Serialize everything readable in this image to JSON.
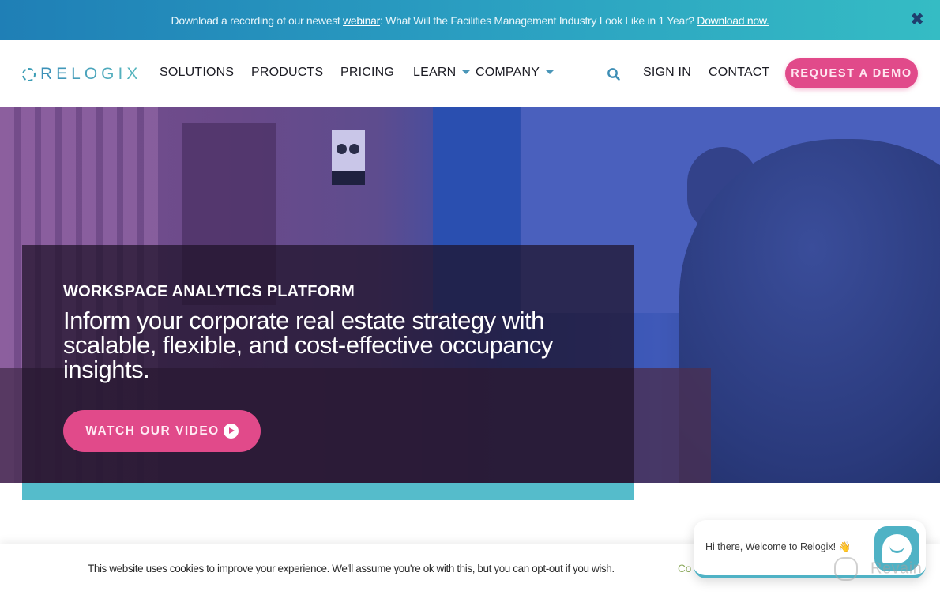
{
  "announcement": {
    "text_before": "Download a recording of our newest ",
    "webinar_link": "webinar",
    "text_middle": ": What Will the Facilities Management Industry Look Like in 1 Year? ",
    "download_link": "Download now.",
    "close_icon": "✖"
  },
  "header": {
    "logo_text": "RELOGIX",
    "nav": {
      "solutions": "SOLUTIONS",
      "products": "PRODUCTS",
      "pricing": "PRICING",
      "learn": "LEARN",
      "company": "COMPANY",
      "sign_in": "SIGN IN",
      "contact": "CONTACT"
    },
    "search_icon": "search-icon",
    "demo_button": "REQUEST A DEMO"
  },
  "hero": {
    "overline": "WORKSPACE ANALYTICS PLATFORM",
    "headline": "Inform your corporate real estate strategy with scalable, flexible, and cost-effective occupancy insights.",
    "video_button": "WATCH OUR VIDEO"
  },
  "cookie": {
    "text": "This website uses cookies to improve your experience. We'll assume you're ok with this, but you can opt-out if you wish.",
    "accept_partial": "Co"
  },
  "chat": {
    "message": "Hi there, Welcome to Relogix! 👋"
  },
  "watermark": {
    "text": "Revain"
  },
  "colors": {
    "brand_pink": "#e14a8a",
    "brand_teal": "#55bccb",
    "announce_start": "#1f7fb6",
    "announce_end": "#35bcc4",
    "nav_text": "#1c1c24"
  }
}
